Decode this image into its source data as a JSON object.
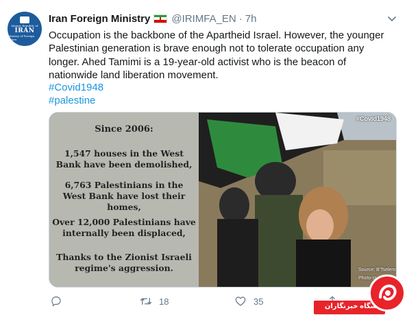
{
  "tweet": {
    "avatar": {
      "line1": "Islamic Republic of",
      "line2": "IRAN",
      "line3": "Ministry of Foreign Affairs",
      "icon": "ministry-logo-icon"
    },
    "author_name": "Iran Foreign Ministry",
    "flag_icon": "iran-flag-icon",
    "handle": "@IRIMFA_EN",
    "separator": "·",
    "time": "7h",
    "text": "Occupation is the backbone of the Apartheid Israel. However, the younger Palestinian generation is brave enough not to tolerate occupation any longer. Ahed Tamimi is a 19-year-old activist who is the beacon of nationwide land liberation movement.",
    "hashtags": [
      "#Covid1948",
      "#palestine"
    ],
    "link_color": "#1b95e0"
  },
  "media": {
    "tag": "#Covid1948",
    "headline": "Since 2006:",
    "facts": [
      "1,547 houses in the West Bank have been demolished,",
      "6,763 Palestinians in the West Bank have lost their homes,",
      "Over 12,000 Palestinians have internally been displaced,",
      "Thanks to the Zionist Israeli regime's aggression."
    ],
    "credit_source": "Source: B'Tselem",
    "credit_photo": "Photo-cr..."
  },
  "actions": {
    "reply_count": "",
    "retweet_count": "18",
    "like_count": "35",
    "icons": [
      "reply-icon",
      "retweet-icon",
      "like-icon",
      "share-icon"
    ]
  },
  "watermark": {
    "text": "باشگاه خبرنگاران",
    "color": "#e8232a"
  }
}
